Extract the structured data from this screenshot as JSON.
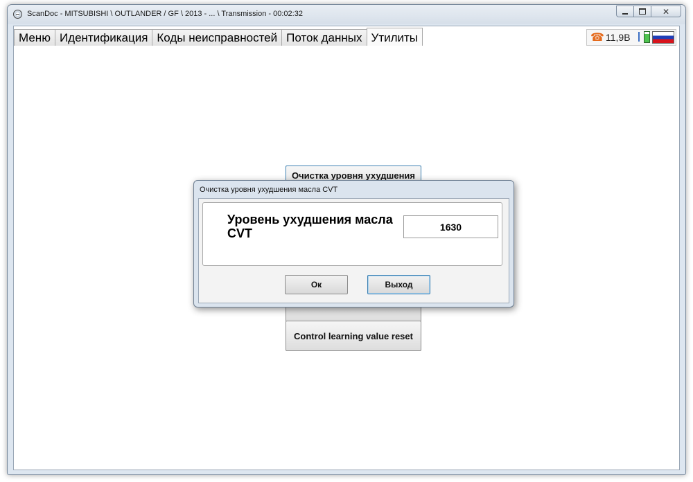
{
  "window": {
    "title": "ScanDoc - MITSUBISHI \\ OUTLANDER / GF \\ 2013 - ... \\ Transmission - 00:02:32",
    "controls": {
      "minimize": "minimize",
      "maximize": "maximize",
      "close": "close"
    }
  },
  "tabs": [
    {
      "label": "Меню"
    },
    {
      "label": "Идентификация"
    },
    {
      "label": "Коды неисправностей"
    },
    {
      "label": "Поток данных"
    },
    {
      "label": "Утилиты",
      "active": true
    }
  ],
  "status": {
    "voltage": "11,9В",
    "icons": [
      "phone-icon",
      "plug-icon",
      "battery-icon",
      "russian-flag-icon"
    ]
  },
  "utilities": {
    "buttons": [
      {
        "label": "Очистка уровня ухудшения"
      },
      {
        "label": "Control learning value reset"
      }
    ]
  },
  "dialog": {
    "title": "Очистка уровня ухудшения масла CVT",
    "parameter_label": "Уровень ухудшения масла CVT",
    "value": "1630",
    "ok_label": "Ок",
    "exit_label": "Выход"
  },
  "colors": {
    "phone": "#e56a1c",
    "focus_border": "#3c7fb1",
    "flag_blue": "#1f3fb8",
    "flag_red": "#d8141c",
    "battery_green": "#4fc44f"
  }
}
